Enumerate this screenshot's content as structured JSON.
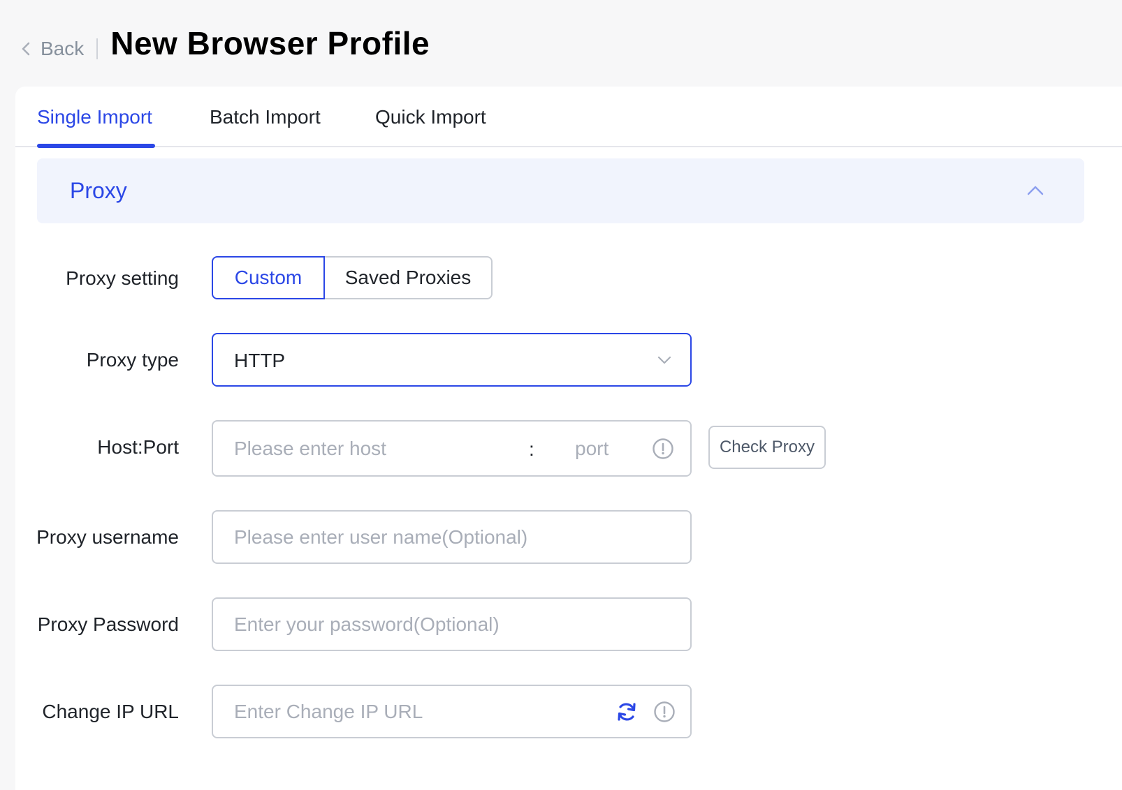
{
  "header": {
    "back_label": "Back",
    "title": "New Browser Profile"
  },
  "tabs": [
    {
      "label": "Single Import",
      "active": true
    },
    {
      "label": "Batch Import",
      "active": false
    },
    {
      "label": "Quick Import",
      "active": false
    }
  ],
  "section": {
    "title": "Proxy",
    "expanded": true
  },
  "form": {
    "proxy_setting": {
      "label": "Proxy setting",
      "options": [
        "Custom",
        "Saved Proxies"
      ],
      "selected": "Custom"
    },
    "proxy_type": {
      "label": "Proxy type",
      "value": "HTTP"
    },
    "host_port": {
      "label": "Host:Port",
      "host_placeholder": "Please enter host",
      "separator": ":",
      "port_placeholder": "port",
      "check_button": "Check Proxy"
    },
    "proxy_username": {
      "label": "Proxy username",
      "placeholder": "Please enter user name(Optional)"
    },
    "proxy_password": {
      "label": "Proxy Password",
      "placeholder": "Enter your password(Optional)"
    },
    "change_ip_url": {
      "label": "Change IP URL",
      "placeholder": "Enter Change IP URL"
    }
  },
  "icons": {
    "back": "chevron-left-icon",
    "collapse": "chevron-up-icon",
    "dropdown": "chevron-down-icon",
    "info": "info-circle-icon",
    "refresh": "refresh-icon"
  },
  "colors": {
    "accent": "#2b47e6",
    "section_bg": "#f1f4fd",
    "border": "#c9cdd4",
    "placeholder": "#a9aeb8"
  }
}
